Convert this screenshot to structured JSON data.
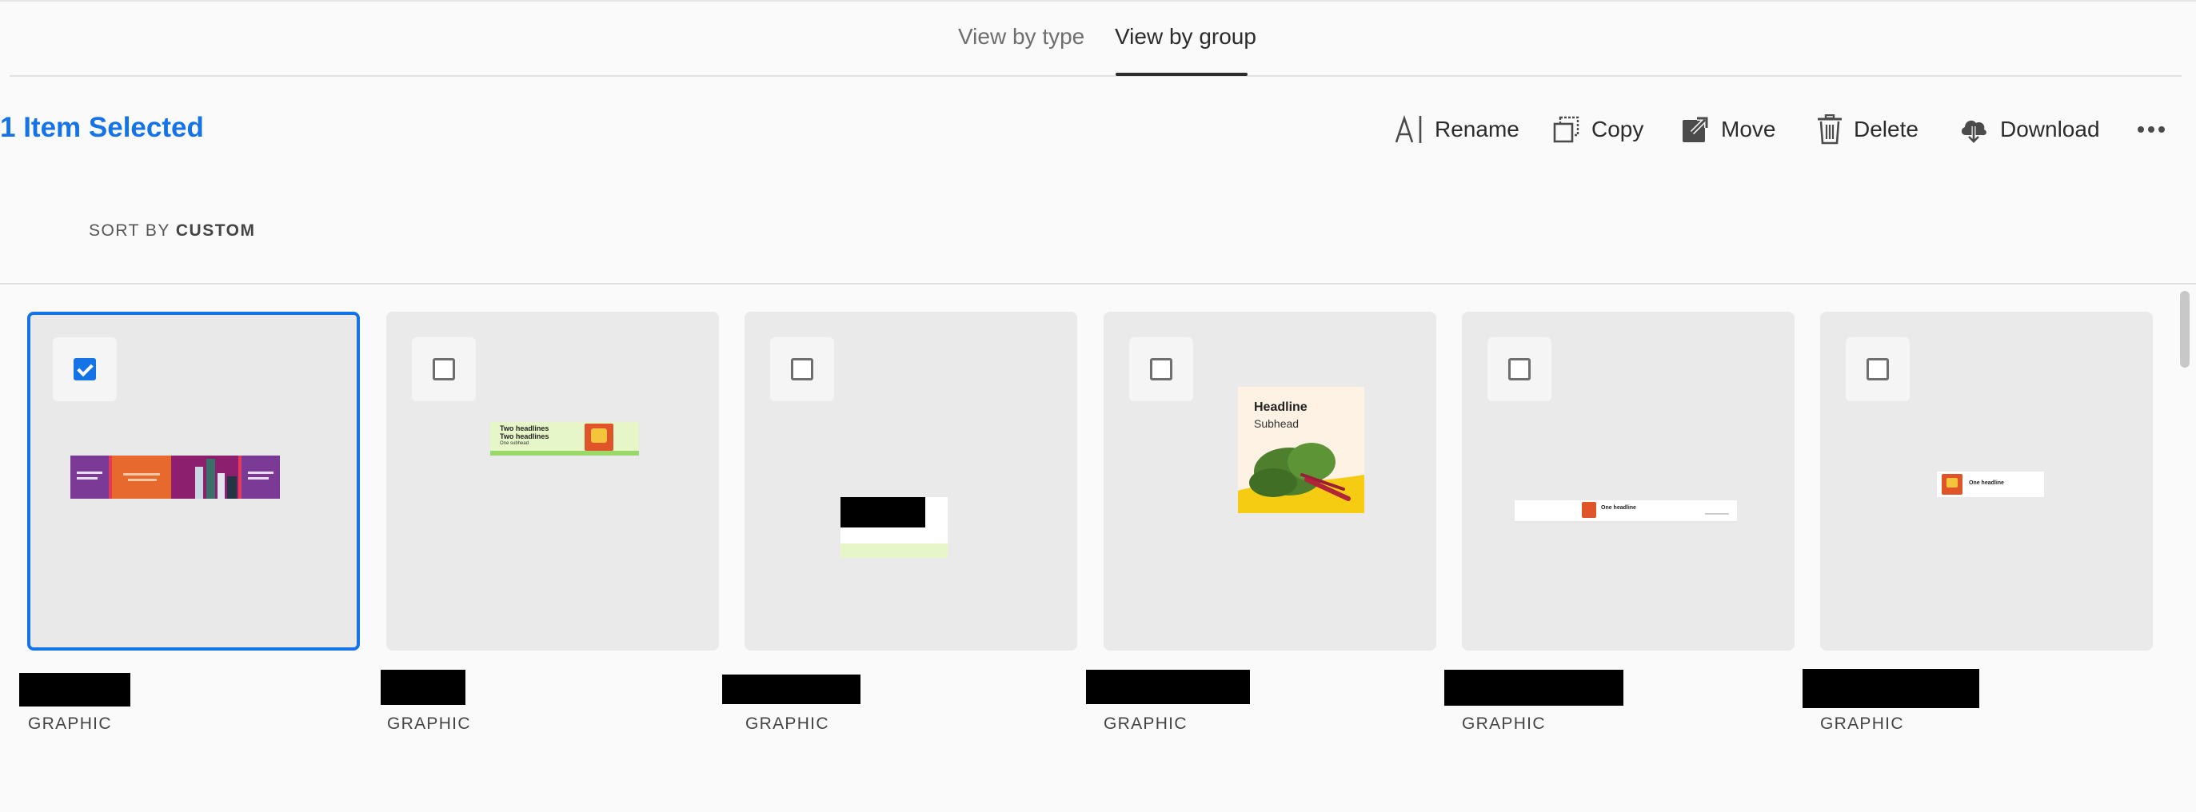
{
  "tabs": [
    {
      "label": "View by type"
    },
    {
      "label": "View by group"
    }
  ],
  "selection": {
    "count_label": "1 Item Selected"
  },
  "actions": {
    "rename": "Rename",
    "copy": "Copy",
    "move": "Move",
    "delete": "Delete",
    "download": "Download"
  },
  "sort": {
    "prefix": "SORT BY",
    "value": "CUSTOM"
  },
  "thumb_text": {
    "card2_line1": "Two headlines",
    "card2_line2": "Two headlines",
    "card2_line3": "One subhead",
    "card4_headline": "Headline",
    "card4_subhead": "Subhead",
    "card5_headline": "One headline",
    "card6_headline": "One headline"
  },
  "assets": [
    {
      "type": "GRAPHIC",
      "selected": true
    },
    {
      "type": "GRAPHIC",
      "selected": false
    },
    {
      "type": "GRAPHIC",
      "selected": false
    },
    {
      "type": "GRAPHIC",
      "selected": false
    },
    {
      "type": "GRAPHIC",
      "selected": false
    },
    {
      "type": "GRAPHIC",
      "selected": false
    }
  ],
  "colors": {
    "accent": "#1473e6",
    "card_bg": "#eaeaea",
    "page_bg": "#fafafa"
  }
}
